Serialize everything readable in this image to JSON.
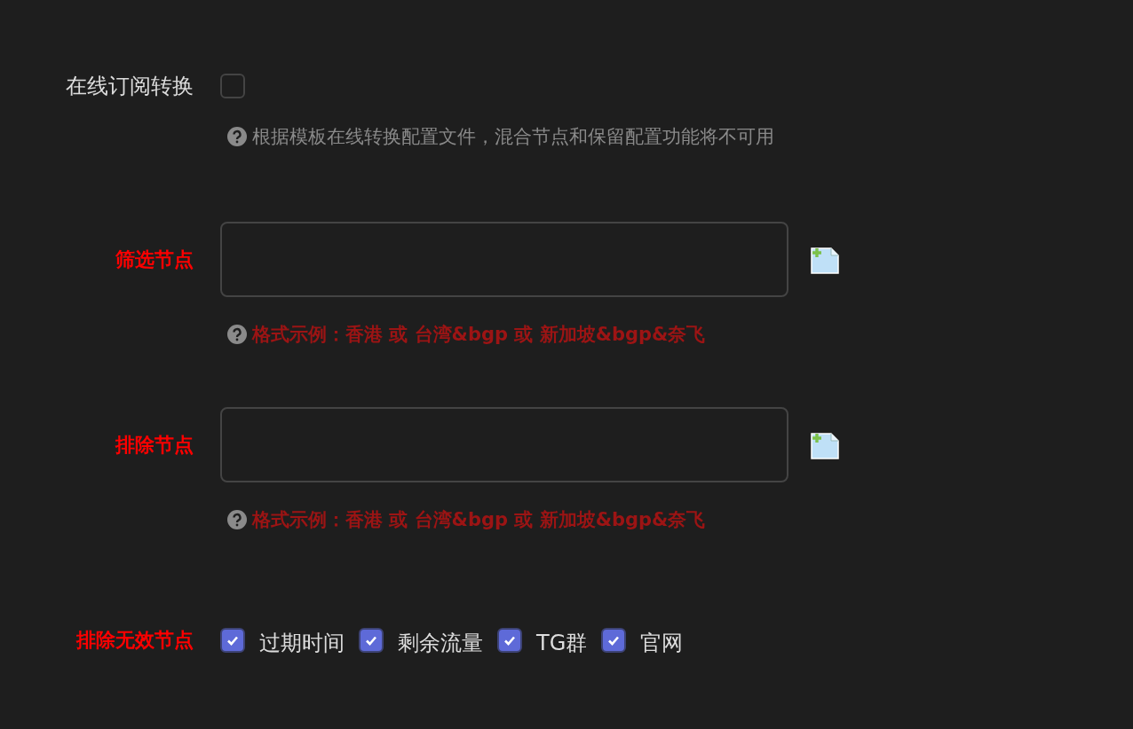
{
  "subscription_convert": {
    "label": "在线订阅转换",
    "checked": false,
    "hint": "根据模板在线转换配置文件，混合节点和保留配置功能将不可用"
  },
  "filters": [
    {
      "label": "筛选节点",
      "hint": "格式示例：香港 或 台湾&bgp 或 新加坡&bgp&奈飞"
    },
    {
      "label": "排除节点",
      "hint": "格式示例：香港 或 台湾&bgp 或 新加坡&bgp&奈飞"
    }
  ],
  "exclude_invalid": {
    "label": "排除无效节点",
    "options": [
      {
        "label": "过期时间",
        "checked": true
      },
      {
        "label": "剩余流量",
        "checked": true
      },
      {
        "label": "TG群",
        "checked": true
      },
      {
        "label": "官网",
        "checked": true
      }
    ]
  }
}
